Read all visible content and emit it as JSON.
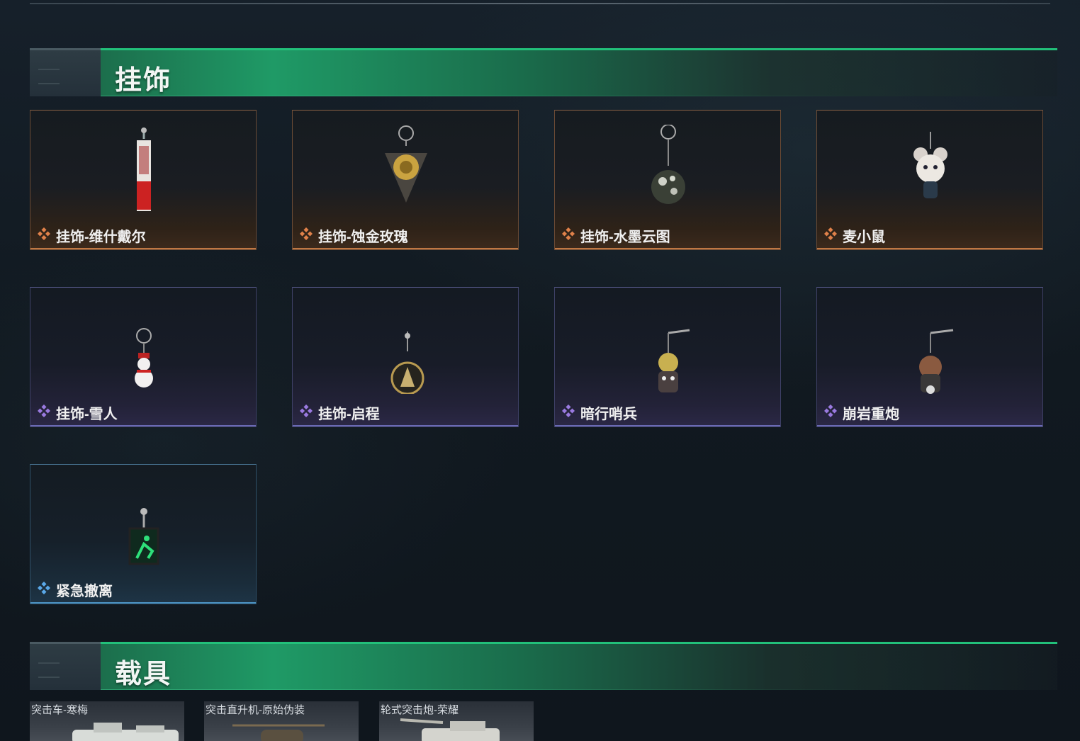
{
  "sections": {
    "charms": {
      "title": "挂饰"
    },
    "vehicles": {
      "title": "载具"
    }
  },
  "charms": [
    {
      "name": "挂饰-维什戴尔",
      "rarity": "gold",
      "icon": "vishdel-tag-charm"
    },
    {
      "name": "挂饰-蚀金玫瑰",
      "rarity": "gold",
      "icon": "gold-rose-charm"
    },
    {
      "name": "挂饰-水墨云图",
      "rarity": "gold",
      "icon": "ink-cloud-ball-charm"
    },
    {
      "name": "麦小鼠",
      "rarity": "gold",
      "icon": "mouse-charm"
    },
    {
      "name": "挂饰-雪人",
      "rarity": "purple",
      "icon": "snowman-charm"
    },
    {
      "name": "挂饰-启程",
      "rarity": "purple",
      "icon": "departure-medal-charm"
    },
    {
      "name": "暗行哨兵",
      "rarity": "purple",
      "icon": "sentinel-figure-charm"
    },
    {
      "name": "崩岩重炮",
      "rarity": "purple",
      "icon": "cannon-figure-charm"
    },
    {
      "name": "紧急撤离",
      "rarity": "blue",
      "icon": "emergency-exit-sign-charm"
    }
  ],
  "vehicles": [
    {
      "name": "突击车-寒梅"
    },
    {
      "name": "突击直升机-原始伪装"
    },
    {
      "name": "轮式突击炮-荣耀"
    }
  ],
  "colors": {
    "gold": "#e0814a",
    "purple": "#9a7ae0",
    "blue": "#5aa8e8",
    "header_green": "#1f9a66"
  }
}
